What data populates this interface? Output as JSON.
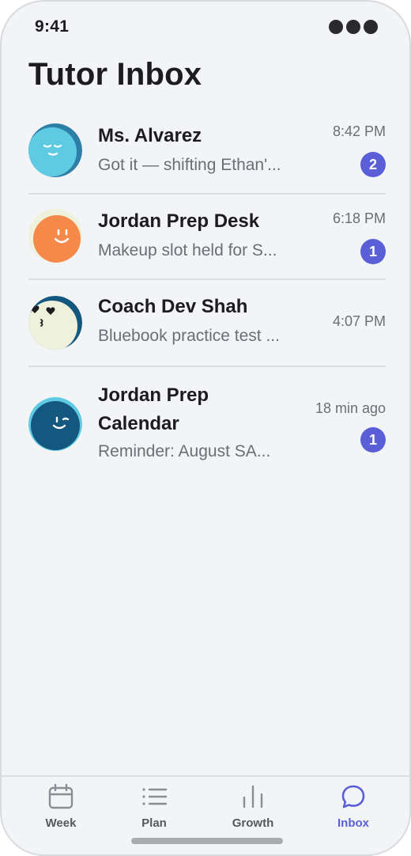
{
  "status_bar": {
    "time": "9:41"
  },
  "page": {
    "title": "Tutor Inbox"
  },
  "conversations": [
    {
      "name_line1": "Ms. Alvarez",
      "name_line2": "",
      "preview": "Got it — shifting Ethan'...",
      "time": "8:42 PM",
      "unread": "2",
      "avatar_color": "#5fcbe2",
      "avatar_rim": "#2e7fa7"
    },
    {
      "name_line1": "Jordan Prep Desk",
      "name_line2": "",
      "preview": "Makeup slot held for S...",
      "time": "6:18 PM",
      "unread": "1",
      "avatar_color": "#f5894a",
      "avatar_rim": "#eef1dc"
    },
    {
      "name_line1": "Coach Dev Shah",
      "name_line2": "",
      "preview": "Bluebook practice test ...",
      "time": "4:07 PM",
      "unread": "",
      "avatar_color": "#eef1dc",
      "avatar_rim": "#14577f"
    },
    {
      "name_line1": "Jordan Prep",
      "name_line2": "Calendar",
      "preview": "Reminder: August SA...",
      "time": "18 min ago",
      "unread": "1",
      "avatar_color": "#14577f",
      "avatar_rim": "#5fcbe2"
    }
  ],
  "tab_bar": {
    "tabs": [
      {
        "label": "Week",
        "icon": "calendar-icon"
      },
      {
        "label": "Plan",
        "icon": "list-icon"
      },
      {
        "label": "Growth",
        "icon": "bar-chart-icon"
      },
      {
        "label": "Inbox",
        "icon": "chat-bubble-icon"
      }
    ],
    "active": "Inbox"
  },
  "colors": {
    "background": "#f3f4f6",
    "badge": "#5a5fd8",
    "accent": "#5a5fd8",
    "text_primary": "#1c1c1e",
    "text_secondary": "#6b6e76"
  }
}
